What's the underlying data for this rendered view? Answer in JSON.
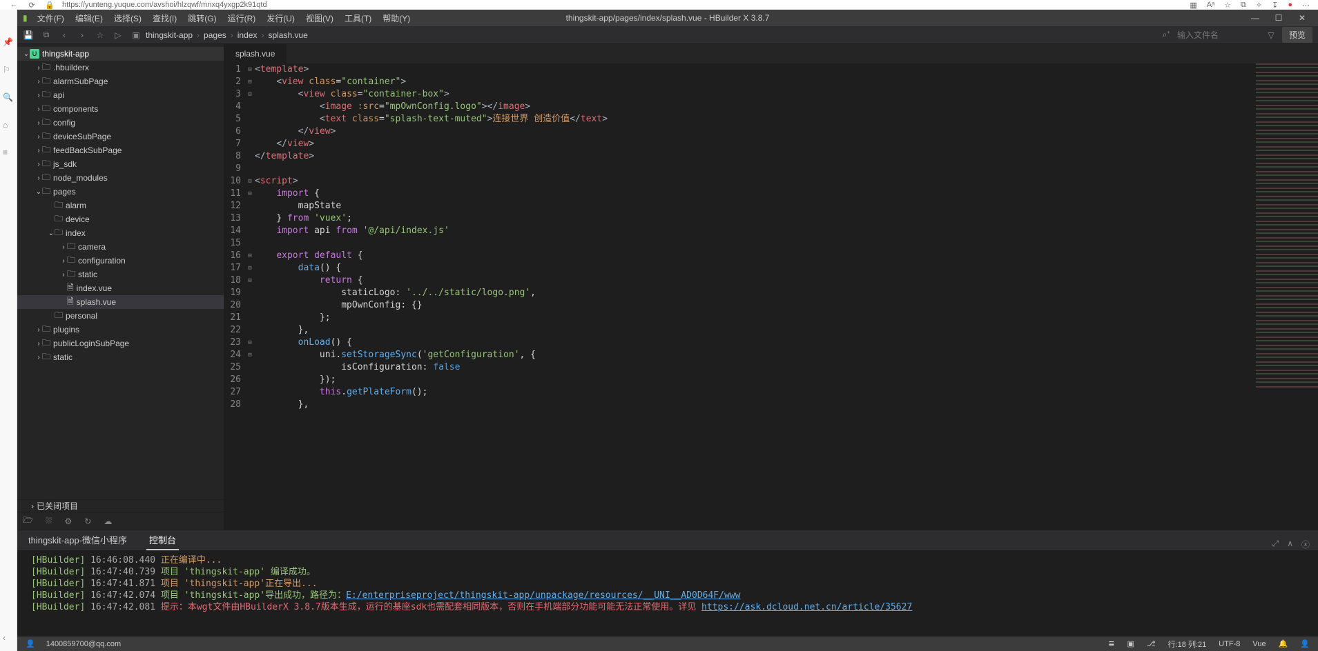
{
  "browser": {
    "url": "https://yunteng.yuque.com/avshoi/hlzqwf/mnxq4yxgp2k91qtd"
  },
  "titlebar": {
    "menus": [
      "文件(F)",
      "编辑(E)",
      "选择(S)",
      "查找(I)",
      "跳转(G)",
      "运行(R)",
      "发行(U)",
      "视图(V)",
      "工具(T)",
      "帮助(Y)"
    ],
    "title": "thingskit-app/pages/index/splash.vue - HBuilder X 3.8.7"
  },
  "toolbar": {
    "breadcrumb": [
      "thingskit-app",
      "pages",
      "index",
      "splash.vue"
    ],
    "search_placeholder": "输入文件名",
    "preview": "预览"
  },
  "tree": {
    "root": "thingskit-app",
    "items": [
      {
        "depth": 1,
        "kind": "folder",
        "label": ".hbuilderx",
        "chev": "›"
      },
      {
        "depth": 1,
        "kind": "folder",
        "label": "alarmSubPage",
        "chev": "›"
      },
      {
        "depth": 1,
        "kind": "folder",
        "label": "api",
        "chev": "›"
      },
      {
        "depth": 1,
        "kind": "folder",
        "label": "components",
        "chev": "›"
      },
      {
        "depth": 1,
        "kind": "folder",
        "label": "config",
        "chev": "›"
      },
      {
        "depth": 1,
        "kind": "folder",
        "label": "deviceSubPage",
        "chev": "›"
      },
      {
        "depth": 1,
        "kind": "folder",
        "label": "feedBackSubPage",
        "chev": "›"
      },
      {
        "depth": 1,
        "kind": "folder",
        "label": "js_sdk",
        "chev": "›"
      },
      {
        "depth": 1,
        "kind": "folder",
        "label": "node_modules",
        "chev": "›"
      },
      {
        "depth": 1,
        "kind": "folder",
        "label": "pages",
        "chev": "⌄"
      },
      {
        "depth": 2,
        "kind": "folder",
        "label": "alarm",
        "chev": ""
      },
      {
        "depth": 2,
        "kind": "folder",
        "label": "device",
        "chev": ""
      },
      {
        "depth": 2,
        "kind": "folder",
        "label": "index",
        "chev": "⌄"
      },
      {
        "depth": 3,
        "kind": "folder",
        "label": "camera",
        "chev": "›"
      },
      {
        "depth": 3,
        "kind": "folder",
        "label": "configuration",
        "chev": "›"
      },
      {
        "depth": 3,
        "kind": "folder",
        "label": "static",
        "chev": "›"
      },
      {
        "depth": 3,
        "kind": "file",
        "label": "index.vue"
      },
      {
        "depth": 3,
        "kind": "file",
        "label": "splash.vue",
        "selected": true
      },
      {
        "depth": 2,
        "kind": "folder",
        "label": "personal",
        "chev": ""
      },
      {
        "depth": 1,
        "kind": "folder",
        "label": "plugins",
        "chev": "›"
      },
      {
        "depth": 1,
        "kind": "folder",
        "label": "publicLoginSubPage",
        "chev": "›"
      },
      {
        "depth": 1,
        "kind": "folder",
        "label": "static",
        "chev": "›"
      }
    ],
    "closed_projects": "已关闭项目"
  },
  "editor": {
    "tab": "splash.vue",
    "lines": [
      {
        "n": 1,
        "html": "<span class='tok-punct'>&lt;</span><span class='tok-tag'>template</span><span class='tok-punct'>&gt;</span>",
        "fold": "⊟"
      },
      {
        "n": 2,
        "html": "    <span class='tok-punct'>&lt;</span><span class='tok-tag'>view</span> <span class='tok-attr'>class</span>=<span class='tok-str'>\"container\"</span><span class='tok-punct'>&gt;</span>",
        "fold": "⊟"
      },
      {
        "n": 3,
        "html": "        <span class='tok-punct'>&lt;</span><span class='tok-tag'>view</span> <span class='tok-attr'>class</span>=<span class='tok-str'>\"container-box\"</span><span class='tok-punct'>&gt;</span>",
        "fold": "⊟"
      },
      {
        "n": 4,
        "html": "            <span class='tok-punct'>&lt;</span><span class='tok-tag'>image</span> <span class='tok-attr'>:src</span>=<span class='tok-str'>\"mpOwnConfig.logo\"</span><span class='tok-punct'>&gt;&lt;/</span><span class='tok-tag'>image</span><span class='tok-punct'>&gt;</span>"
      },
      {
        "n": 5,
        "html": "            <span class='tok-punct'>&lt;</span><span class='tok-tag'>text</span> <span class='tok-attr'>class</span>=<span class='tok-str'>\"splash-text-muted\"</span><span class='tok-punct'>&gt;</span><span class='tok-txt'>连接世界 创造价值</span><span class='tok-punct'>&lt;/</span><span class='tok-tag'>text</span><span class='tok-punct'>&gt;</span>"
      },
      {
        "n": 6,
        "html": "        <span class='tok-punct'>&lt;/</span><span class='tok-tag'>view</span><span class='tok-punct'>&gt;</span>"
      },
      {
        "n": 7,
        "html": "    <span class='tok-punct'>&lt;/</span><span class='tok-tag'>view</span><span class='tok-punct'>&gt;</span>"
      },
      {
        "n": 8,
        "html": "<span class='tok-punct'>&lt;/</span><span class='tok-tag'>template</span><span class='tok-punct'>&gt;</span>"
      },
      {
        "n": 9,
        "html": " "
      },
      {
        "n": 10,
        "html": "<span class='tok-punct'>&lt;</span><span class='tok-tag'>script</span><span class='tok-punct'>&gt;</span>",
        "fold": "⊟"
      },
      {
        "n": 11,
        "html": "    <span class='tok-key'>import</span> {",
        "fold": "⊟"
      },
      {
        "n": 12,
        "html": "        mapState"
      },
      {
        "n": 13,
        "html": "    } <span class='tok-key'>from</span> <span class='tok-str'>'vuex'</span>;"
      },
      {
        "n": 14,
        "html": "    <span class='tok-key'>import</span> api <span class='tok-key'>from</span> <span class='tok-str'>'@/api/index.js'</span>"
      },
      {
        "n": 15,
        "html": " "
      },
      {
        "n": 16,
        "html": "    <span class='tok-key'>export</span> <span class='tok-key'>default</span> {",
        "fold": "⊟"
      },
      {
        "n": 17,
        "html": "        <span class='tok-fn'>data</span>() {",
        "fold": "⊟"
      },
      {
        "n": 18,
        "html": "            <span class='tok-key'>return</span> {",
        "fold": "⊟"
      },
      {
        "n": 19,
        "html": "                staticLogo: <span class='tok-str'>'../../static/logo.png'</span>,"
      },
      {
        "n": 20,
        "html": "                mpOwnConfig: {}"
      },
      {
        "n": 21,
        "html": "            };"
      },
      {
        "n": 22,
        "html": "        },"
      },
      {
        "n": 23,
        "html": "        <span class='tok-fn'>onLoad</span>() {",
        "fold": "⊟"
      },
      {
        "n": 24,
        "html": "            uni.<span class='tok-fn'>setStorageSync</span>(<span class='tok-str'>'getConfiguration'</span>, {",
        "fold": "⊟"
      },
      {
        "n": 25,
        "html": "                isConfiguration: <span class='tok-bool'>false</span>"
      },
      {
        "n": 26,
        "html": "            });"
      },
      {
        "n": 27,
        "html": "            <span class='tok-key'>this</span>.<span class='tok-fn'>getPlateForm</span>();"
      },
      {
        "n": 28,
        "html": "        },"
      }
    ]
  },
  "console": {
    "tabs": [
      "thingskit-app-微信小程序",
      "控制台"
    ],
    "lines": [
      {
        "tag": "[HBuilder]",
        "time": "16:46:08.440",
        "cls": "l-yellow",
        "msg": "正在编译中..."
      },
      {
        "tag": "[HBuilder]",
        "time": "16:47:40.739",
        "cls": "l-green",
        "msg": "项目 'thingskit-app' 编译成功。"
      },
      {
        "tag": "[HBuilder]",
        "time": "16:47:41.871",
        "cls": "l-yellow",
        "msg": "项目 'thingskit-app'正在导出..."
      },
      {
        "tag": "[HBuilder]",
        "time": "16:47:42.074",
        "cls": "l-green",
        "msg": "项目 'thingskit-app'导出成功，路径为：",
        "link": "E:/enterpriseproject/thingskit-app/unpackage/resources/__UNI__AD0D64F/www"
      },
      {
        "tag": "[HBuilder]",
        "time": "16:47:42.081",
        "cls": "l-red",
        "msg": "提示：本wgt文件由HBuilderX 3.8.7版本生成，运行的基座sdk也需配套相同版本，否则在手机端部分功能可能无法正常使用。详见 ",
        "link": "https://ask.dcloud.net.cn/article/35627"
      }
    ]
  },
  "status": {
    "user": "1400859700@qq.com",
    "pos": "行:18  列:21",
    "enc": "UTF-8",
    "lang": "Vue"
  }
}
